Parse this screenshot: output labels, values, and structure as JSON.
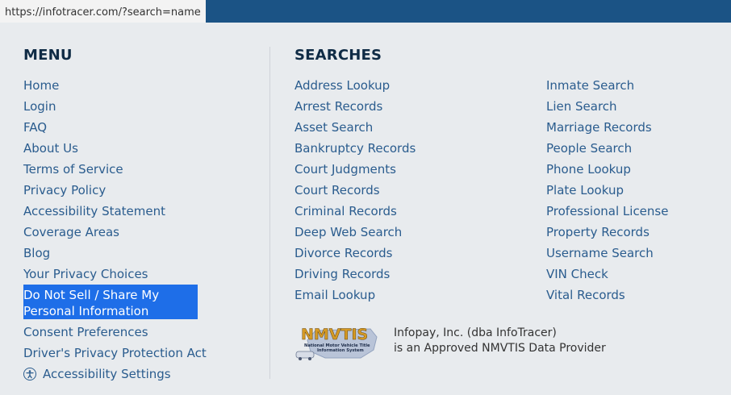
{
  "browser": {
    "url": "https://infotracer.com/?search=name"
  },
  "menu": {
    "heading": "MENU",
    "items": [
      "Home",
      "Login",
      "FAQ",
      "About Us",
      "Terms of Service",
      "Privacy Policy",
      "Accessibility Statement",
      "Coverage Areas",
      "Blog",
      "Your Privacy Choices",
      "Do Not Sell / Share My Personal Information",
      "Consent Preferences",
      "Driver's Privacy Protection Act",
      "Accessibility Settings"
    ]
  },
  "searches": {
    "heading": "SEARCHES",
    "col1": [
      "Address Lookup",
      "Arrest Records",
      "Asset Search",
      "Bankruptcy Records",
      "Court Judgments",
      "Court Records",
      "Criminal Records",
      "Deep Web Search",
      "Divorce Records",
      "Driving Records",
      "Email Lookup"
    ],
    "col2": [
      "Inmate Search",
      "Lien Search",
      "Marriage Records",
      "People Search",
      "Phone Lookup",
      "Plate Lookup",
      "Professional License",
      "Property Records",
      "Username Search",
      "VIN Check",
      "Vital Records"
    ]
  },
  "nmvtis": {
    "logo_text": "NMVTIS",
    "logo_subtext": "National Motor Vehicle Title Information System",
    "line1": "Infopay, Inc. (dba InfoTracer)",
    "line2": "is an Approved NMVTIS Data Provider"
  },
  "colors": {
    "link": "#2a5c8e",
    "heading": "#0f2b45",
    "topbar": "#1b5385",
    "selection": "#1e6ee8"
  }
}
